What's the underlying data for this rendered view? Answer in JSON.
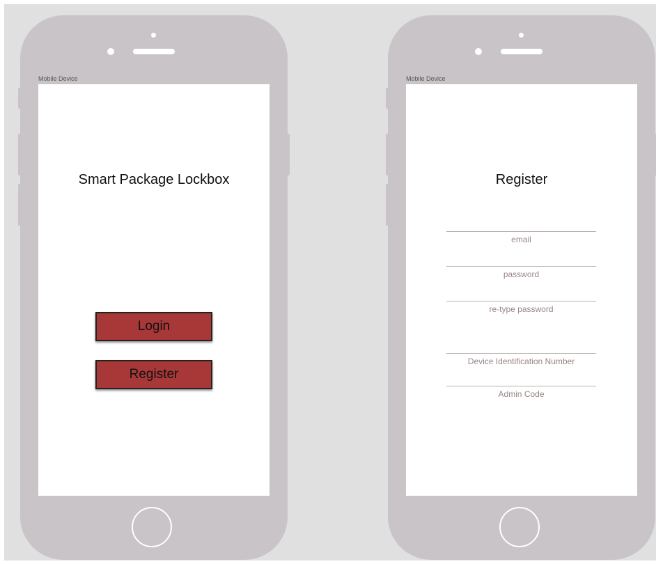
{
  "device_label": "Mobile Device",
  "home_screen": {
    "title": "Smart Package Lockbox",
    "login_label": "Login",
    "register_label": "Register"
  },
  "register_screen": {
    "title": "Register",
    "fields": [
      {
        "placeholder": "email"
      },
      {
        "placeholder": "password"
      },
      {
        "placeholder": "re-type password"
      },
      {
        "placeholder": "Device Identification Number"
      },
      {
        "placeholder": "Admin Code"
      }
    ]
  },
  "colors": {
    "background": "#e0e0e0",
    "phone_body": "#c8c4c7",
    "button": "#a83838",
    "placeholder_text": "#9a8585"
  }
}
